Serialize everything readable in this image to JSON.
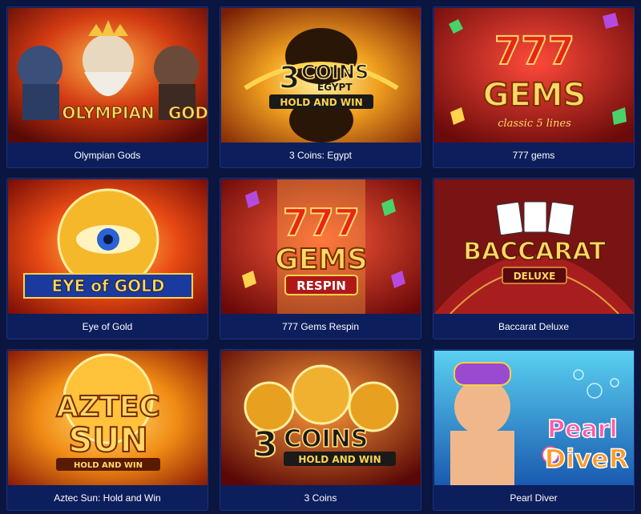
{
  "games": [
    {
      "title": "Olympian Gods",
      "logo_lines": [
        "OLYMPIAN",
        "GODS"
      ]
    },
    {
      "title": "3 Coins: Egypt",
      "logo_lines": [
        "3",
        "COINS",
        "EGYPT",
        "HOLD AND WIN"
      ]
    },
    {
      "title": "777 gems",
      "logo_lines": [
        "777",
        "GEMS",
        "classic 5 lines"
      ]
    },
    {
      "title": "Eye of Gold",
      "logo_lines": [
        "EYE of GOLD"
      ]
    },
    {
      "title": "777 Gems Respin",
      "logo_lines": [
        "777",
        "GEMS",
        "RESPIN"
      ]
    },
    {
      "title": "Baccarat Deluxe",
      "logo_lines": [
        "BACCARAT",
        "DELUXE"
      ]
    },
    {
      "title": "Aztec Sun: Hold and Win",
      "logo_lines": [
        "AZTEC",
        "SUN",
        "HOLD AND WIN"
      ]
    },
    {
      "title": "3 Coins",
      "logo_lines": [
        "3",
        "COINS",
        "HOLD AND WIN"
      ]
    },
    {
      "title": "Pearl Diver",
      "logo_lines": [
        "Pearl",
        "DiveR"
      ]
    }
  ],
  "colors": {
    "page_background": "#0a1540",
    "card_background": "#0d1e5c",
    "card_border": "#1c3278",
    "label_text": "#ffffff"
  }
}
